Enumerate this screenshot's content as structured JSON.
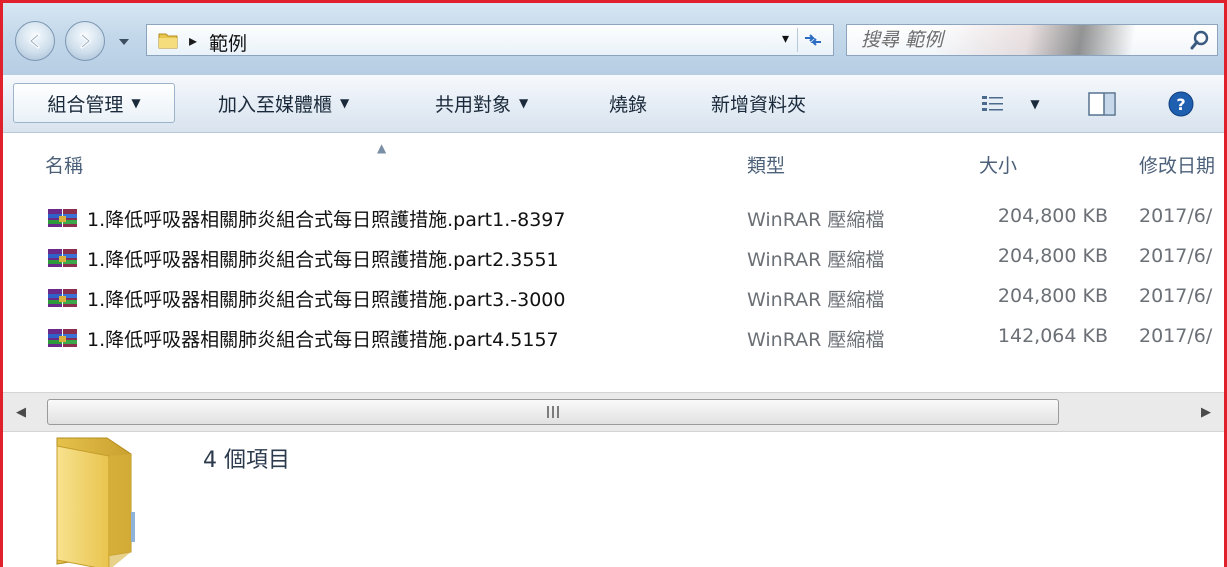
{
  "address": {
    "path": "範例",
    "search_placeholder": "搜尋 範例"
  },
  "toolbar": {
    "organize": "組合管理",
    "add_to_library": "加入至媒體櫃",
    "share_with": "共用對象",
    "burn": "燒錄",
    "new_folder": "新增資料夾"
  },
  "columns": {
    "name": "名稱",
    "type": "類型",
    "size": "大小",
    "date_modified": "修改日期"
  },
  "files": [
    {
      "name": "1.降低呼吸器相關肺炎組合式每日照護措施.part1.-8397",
      "type": "WinRAR 壓縮檔",
      "size": "204,800 KB",
      "date": "2017/6/"
    },
    {
      "name": "1.降低呼吸器相關肺炎組合式每日照護措施.part2.3551",
      "type": "WinRAR 壓縮檔",
      "size": "204,800 KB",
      "date": "2017/6/"
    },
    {
      "name": "1.降低呼吸器相關肺炎組合式每日照護措施.part3.-3000",
      "type": "WinRAR 壓縮檔",
      "size": "204,800 KB",
      "date": "2017/6/"
    },
    {
      "name": "1.降低呼吸器相關肺炎組合式每日照護措施.part4.5157",
      "type": "WinRAR 壓縮檔",
      "size": "142,064 KB",
      "date": "2017/6/"
    }
  ],
  "details": {
    "item_count": "4 個項目"
  },
  "colors": {
    "frame_border": "#e0202a",
    "header_text": "#4c607a",
    "secondary_text": "#6b7076"
  },
  "icons": [
    "back-arrow-icon",
    "forward-arrow-icon",
    "folder-icon",
    "refresh-icon",
    "search-icon",
    "views-icon",
    "preview-pane-icon",
    "help-icon",
    "winrar-icon"
  ]
}
